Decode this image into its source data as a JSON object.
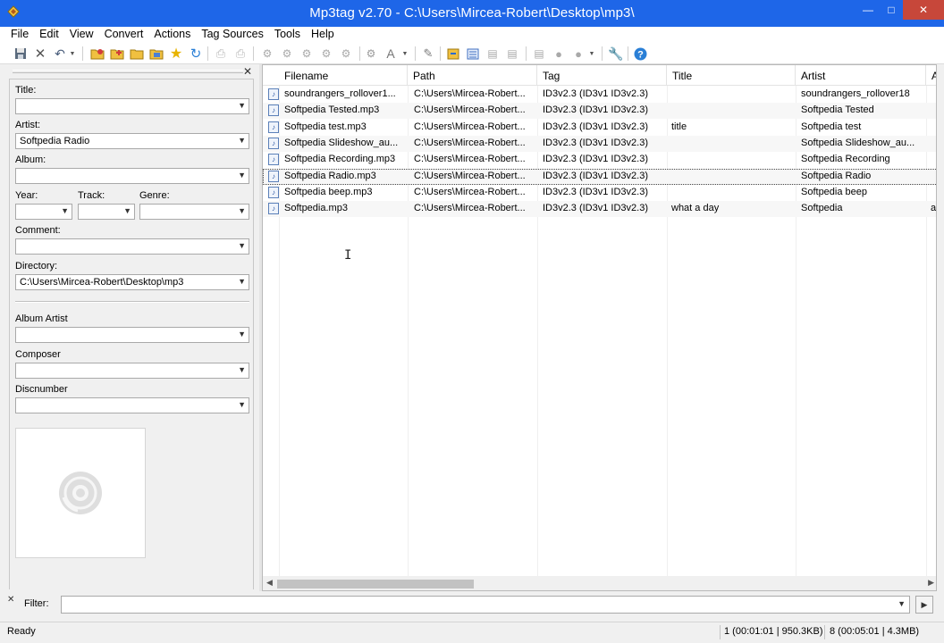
{
  "window": {
    "title": "Mp3tag v2.70  -  C:\\Users\\Mircea-Robert\\Desktop\\mp3\\"
  },
  "menu": [
    "File",
    "Edit",
    "View",
    "Convert",
    "Actions",
    "Tag Sources",
    "Tools",
    "Help"
  ],
  "toolbar_icons": [
    "save-icon",
    "remove-tag-icon",
    "undo-icon",
    "dropdown-icon",
    "change-directory-icon",
    "add-directory-icon",
    "open-folder-icon",
    "favorites-folder-icon",
    "star-icon",
    "refresh-icon",
    "print-icon",
    "print-preview-icon",
    "tag-filename-icon",
    "filename-tag-icon",
    "filename-filename-icon",
    "text-tag-icon",
    "actions-icon",
    "case-conversion-icon",
    "dropdown-icon",
    "edit-icon",
    "export-icon",
    "playlist-icon",
    "tag-tag-icon",
    "autonumber-icon",
    "web-source-icon",
    "freedb-icon",
    "globe-icon",
    "dropdown-icon",
    "options-icon",
    "help-icon"
  ],
  "tag_panel": {
    "title_label": "Title:",
    "title_value": "",
    "artist_label": "Artist:",
    "artist_value": "Softpedia Radio",
    "album_label": "Album:",
    "album_value": "",
    "year_label": "Year:",
    "year_value": "",
    "track_label": "Track:",
    "track_value": "",
    "genre_label": "Genre:",
    "genre_value": "",
    "comment_label": "Comment:",
    "comment_value": "",
    "directory_label": "Directory:",
    "directory_value": "C:\\Users\\Mircea-Robert\\Desktop\\mp3",
    "album_artist_label": "Album Artist",
    "album_artist_value": "",
    "composer_label": "Composer",
    "composer_value": "",
    "discnumber_label": "Discnumber",
    "discnumber_value": ""
  },
  "columns": [
    "Filename",
    "Path",
    "Tag",
    "Title",
    "Artist",
    "A"
  ],
  "files": [
    {
      "filename": "soundrangers_rollover1...",
      "path": "C:\\Users\\Mircea-Robert...",
      "tag": "ID3v2.3 (ID3v1 ID3v2.3)",
      "title": "",
      "artist": "soundrangers_rollover18",
      "album": ""
    },
    {
      "filename": "Softpedia Tested.mp3",
      "path": "C:\\Users\\Mircea-Robert...",
      "tag": "ID3v2.3 (ID3v1 ID3v2.3)",
      "title": "",
      "artist": "Softpedia Tested",
      "album": ""
    },
    {
      "filename": "Softpedia test.mp3",
      "path": "C:\\Users\\Mircea-Robert...",
      "tag": "ID3v2.3 (ID3v1 ID3v2.3)",
      "title": "title",
      "artist": "Softpedia test",
      "album": ""
    },
    {
      "filename": "Softpedia Slideshow_au...",
      "path": "C:\\Users\\Mircea-Robert...",
      "tag": "ID3v2.3 (ID3v1 ID3v2.3)",
      "title": "",
      "artist": "Softpedia Slideshow_au...",
      "album": ""
    },
    {
      "filename": "Softpedia Recording.mp3",
      "path": "C:\\Users\\Mircea-Robert...",
      "tag": "ID3v2.3 (ID3v1 ID3v2.3)",
      "title": "",
      "artist": "Softpedia Recording",
      "album": ""
    },
    {
      "filename": "Softpedia Radio.mp3",
      "path": "C:\\Users\\Mircea-Robert...",
      "tag": "ID3v2.3 (ID3v1 ID3v2.3)",
      "title": "",
      "artist": "Softpedia Radio",
      "album": ""
    },
    {
      "filename": "Softpedia beep.mp3",
      "path": "C:\\Users\\Mircea-Robert...",
      "tag": "ID3v2.3 (ID3v1 ID3v2.3)",
      "title": "",
      "artist": "Softpedia beep",
      "album": ""
    },
    {
      "filename": "Softpedia.mp3",
      "path": "C:\\Users\\Mircea-Robert...",
      "tag": "ID3v2.3 (ID3v1 ID3v2.3)",
      "title": "what a day",
      "artist": "Softpedia",
      "album": "al"
    }
  ],
  "filter": {
    "label": "Filter:",
    "value": ""
  },
  "status": {
    "state": "Ready",
    "selected": "1 (00:01:01 | 950.3KB)",
    "total": "8 (00:05:01 | 4.3MB)"
  },
  "colors": {
    "titlebar": "#1e66e8",
    "close_button": "#c7473a"
  }
}
